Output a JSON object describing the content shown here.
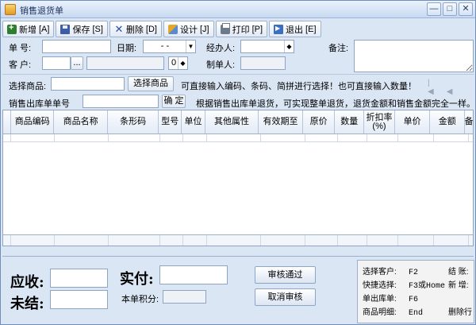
{
  "window": {
    "title": "销售退货单",
    "min_label": "—",
    "max_label": "□",
    "close_label": "✕"
  },
  "toolbar": {
    "add": {
      "label": "新增",
      "key": "[A]"
    },
    "save": {
      "label": "保存",
      "key": "[S]"
    },
    "delete": {
      "label": "删除",
      "key": "[D]"
    },
    "design": {
      "label": "设计",
      "key": "[J]"
    },
    "print": {
      "label": "打印",
      "key": "[P]"
    },
    "exit": {
      "label": "退出",
      "key": "[E]"
    }
  },
  "form": {
    "doc_no_label": "单  号:",
    "doc_no_value": "",
    "date_label": "日期:",
    "date_value": "- -",
    "handler_label": "经办人:",
    "handler_value": "",
    "remark_label": "备注:",
    "customer_label": "客  户:",
    "customer_value": "",
    "customer_browse": "...",
    "spin_value": "0",
    "maker_label": "制单人:",
    "maker_value": ""
  },
  "select_goods": {
    "label": "选择商品:",
    "button": "选择商品",
    "hint": "可直接输入编码、条码、简拼进行选择！也可直接输入数量！"
  },
  "outbound": {
    "label": "销售出库单单号",
    "button": "确 定",
    "hint": "根据销售出库单退货，可实现整单退货，退货金额和销售金额完全一样。"
  },
  "grid": {
    "columns": [
      "商品编码",
      "商品名称",
      "条形码",
      "型号",
      "单位",
      "其他属性",
      "有效期至",
      "原价",
      "数量",
      "折扣率\n(%)",
      "单价",
      "金额",
      "备"
    ]
  },
  "bottom": {
    "receivable_label": "应收:",
    "paid_label": "实付:",
    "unsettled_label": "未结:",
    "points_label": "本单积分:",
    "approve_button": "审核通过",
    "cancel_approve_button": "取消审核"
  },
  "shortcuts": [
    {
      "k": "选择客户:",
      "v": "F2",
      "t": "结  账:"
    },
    {
      "k": "快捷选择:",
      "v": "F3或Home",
      "t": "新  增:"
    },
    {
      "k": "单出库单:",
      "v": "F6",
      "t": ""
    },
    {
      "k": "商品明细:",
      "v": "End",
      "t": "删除行"
    }
  ]
}
